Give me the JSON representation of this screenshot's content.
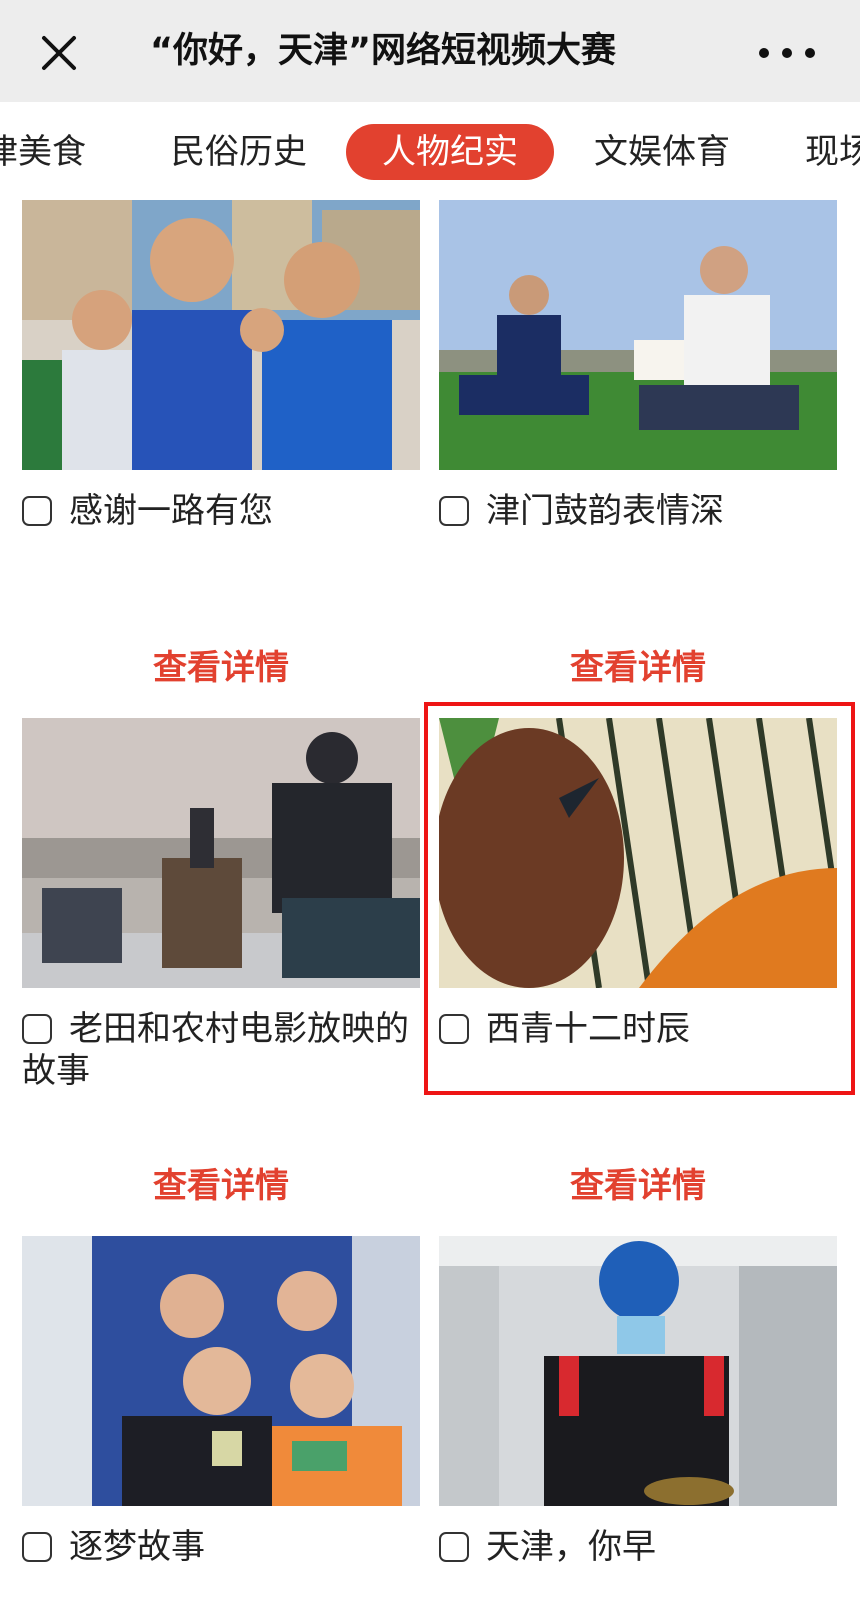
{
  "header": {
    "title": "“你好，天津”网络短视频大赛",
    "close_icon": "close-icon",
    "more_icon": "more-icon"
  },
  "tabs": [
    {
      "label": "津美食"
    },
    {
      "label": "民俗历史"
    },
    {
      "label": "人物纪实",
      "active": true
    },
    {
      "label": "文娱体育"
    },
    {
      "label": "现场"
    }
  ],
  "videos": [
    {
      "title": "感谢一路有您",
      "detail_label": "查看详情"
    },
    {
      "title": "津门鼓韵表情深",
      "detail_label": "查看详情"
    },
    {
      "title": "老田和农村电影放映的故事",
      "detail_label": "查看详情"
    },
    {
      "title": "西青十二时辰",
      "detail_label": "查看详情",
      "highlighted": true
    },
    {
      "title": "逐梦故事"
    },
    {
      "title": "天津，你早"
    }
  ],
  "colors": {
    "accent": "#e2412f",
    "highlight_border": "#ee1515",
    "topbar_bg": "#ededed"
  }
}
